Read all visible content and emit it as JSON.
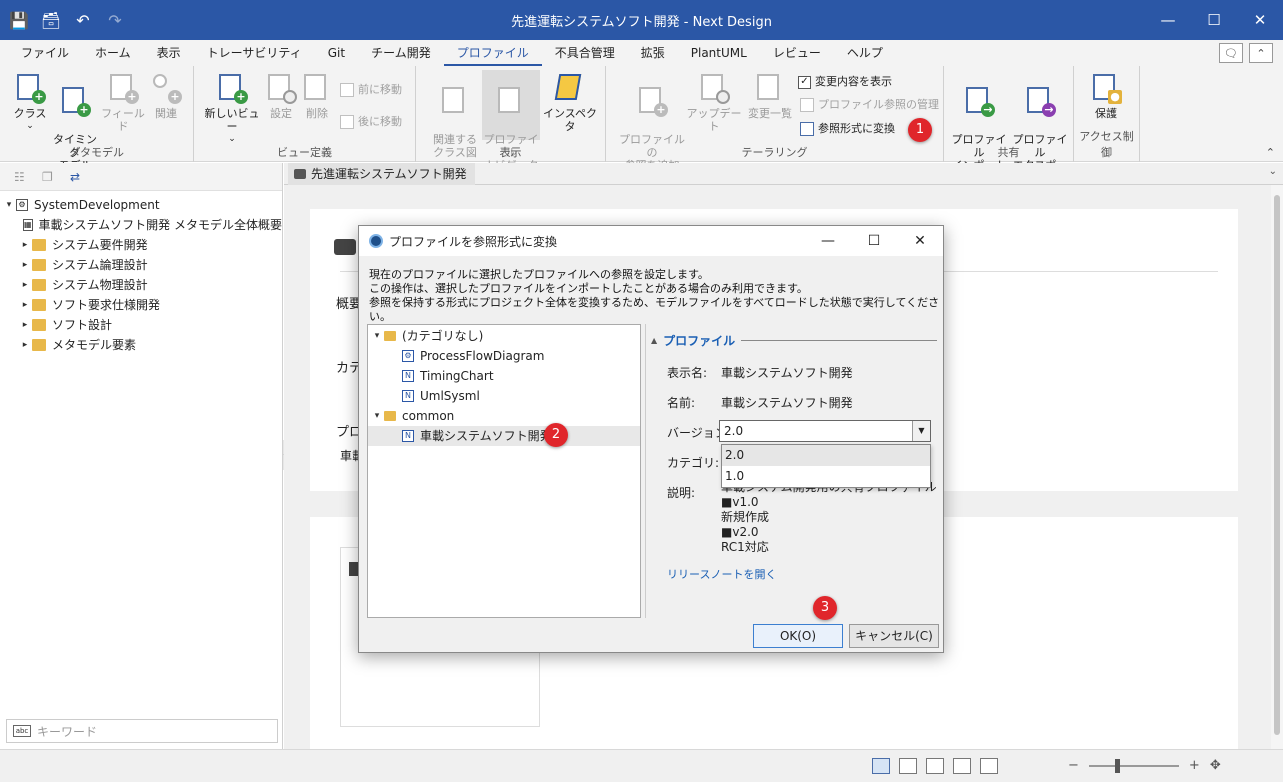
{
  "window": {
    "title": "先進運転システムソフト開発 - Next Design"
  },
  "ribbon_tabs": [
    "ファイル",
    "ホーム",
    "表示",
    "トレーサビリティ",
    "Git",
    "チーム開発",
    "プロファイル",
    "不具合管理",
    "拡張",
    "PlantUML",
    "レビュー",
    "ヘルプ"
  ],
  "active_tab": "プロファイル",
  "groups": {
    "metamodel": {
      "label": "メタモデル",
      "class": "クラス",
      "timing": "タイミング\nモデル",
      "field": "フィールド",
      "relation": "関連"
    },
    "viewdef": {
      "label": "ビュー定義",
      "new_view": "新しいビュー",
      "settings": "設定",
      "delete": "削除",
      "move_prev": "前に移動",
      "move_next": "後に移動"
    },
    "display": {
      "label": "表示",
      "related_class": "関連する\nクラス図",
      "profile_nav": "プロファイル\nナビゲータ",
      "inspector": "インスペクタ"
    },
    "tailoring": {
      "label": "テーラリング",
      "add_ref": "プロファイルの\n参照を追加",
      "update": "アップデート",
      "change_list": "変更一覧",
      "show_changes": "変更内容を表示",
      "manage_ref": "プロファイル参照の管理",
      "convert_ref": "参照形式に変換"
    },
    "share": {
      "label": "共有",
      "import": "プロファイル\nインポート",
      "export": "プロファイル\nエクスポート"
    },
    "access": {
      "label": "アクセス制御",
      "protect": "保護"
    }
  },
  "left_tree": {
    "root": "SystemDevelopment",
    "items": [
      "車載システムソフト開発 メタモデル全体概要",
      "システム要件開発",
      "システム論理設計",
      "システム物理設計",
      "ソフト要求仕様開発",
      "ソフト設計",
      "メタモデル要素"
    ],
    "search_placeholder": "キーワード"
  },
  "document": {
    "tab": "先進運転システムソフト開発",
    "fragments": [
      "概要",
      "カテゴ",
      "プロフ",
      "車載"
    ]
  },
  "dialog": {
    "title": "プロファイルを参照形式に変換",
    "description": [
      "現在のプロファイルに選択したプロファイルへの参照を設定します。",
      "この操作は、選択したプロファイルをインポートしたことがある場合のみ利用できます。",
      "参照を保持する形式にプロジェクト全体を変換するため、モデルファイルをすべてロードした状態で実行してください。"
    ],
    "tree": {
      "category_none": "(カテゴリなし)",
      "items_none": [
        "ProcessFlowDiagram",
        "TimingChart",
        "UmlSysml"
      ],
      "category_common": "common",
      "items_common": [
        "車載システムソフト開発"
      ]
    },
    "props": {
      "section": "プロファイル",
      "display_name_label": "表示名:",
      "display_name": "車載システムソフト開発",
      "name_label": "名前:",
      "name": "車載システムソフト開発",
      "version_label": "バージョン:",
      "version": "2.0",
      "version_options": [
        "2.0",
        "1.0"
      ],
      "category_label": "カテゴリ:",
      "description_label": "説明:",
      "description_lines": [
        "車載システム開発用の共有プロファイル",
        "■v1.0",
        "新規作成",
        "■v2.0",
        "RC1対応"
      ],
      "release_notes": "リリースノートを開く"
    },
    "ok": "OK(O)",
    "cancel": "キャンセル(C)"
  },
  "badges": [
    "1",
    "2",
    "3"
  ],
  "colors": {
    "titlebar": "#2b57a6",
    "badge": "#e0262b",
    "accent": "#1a5fb4"
  }
}
